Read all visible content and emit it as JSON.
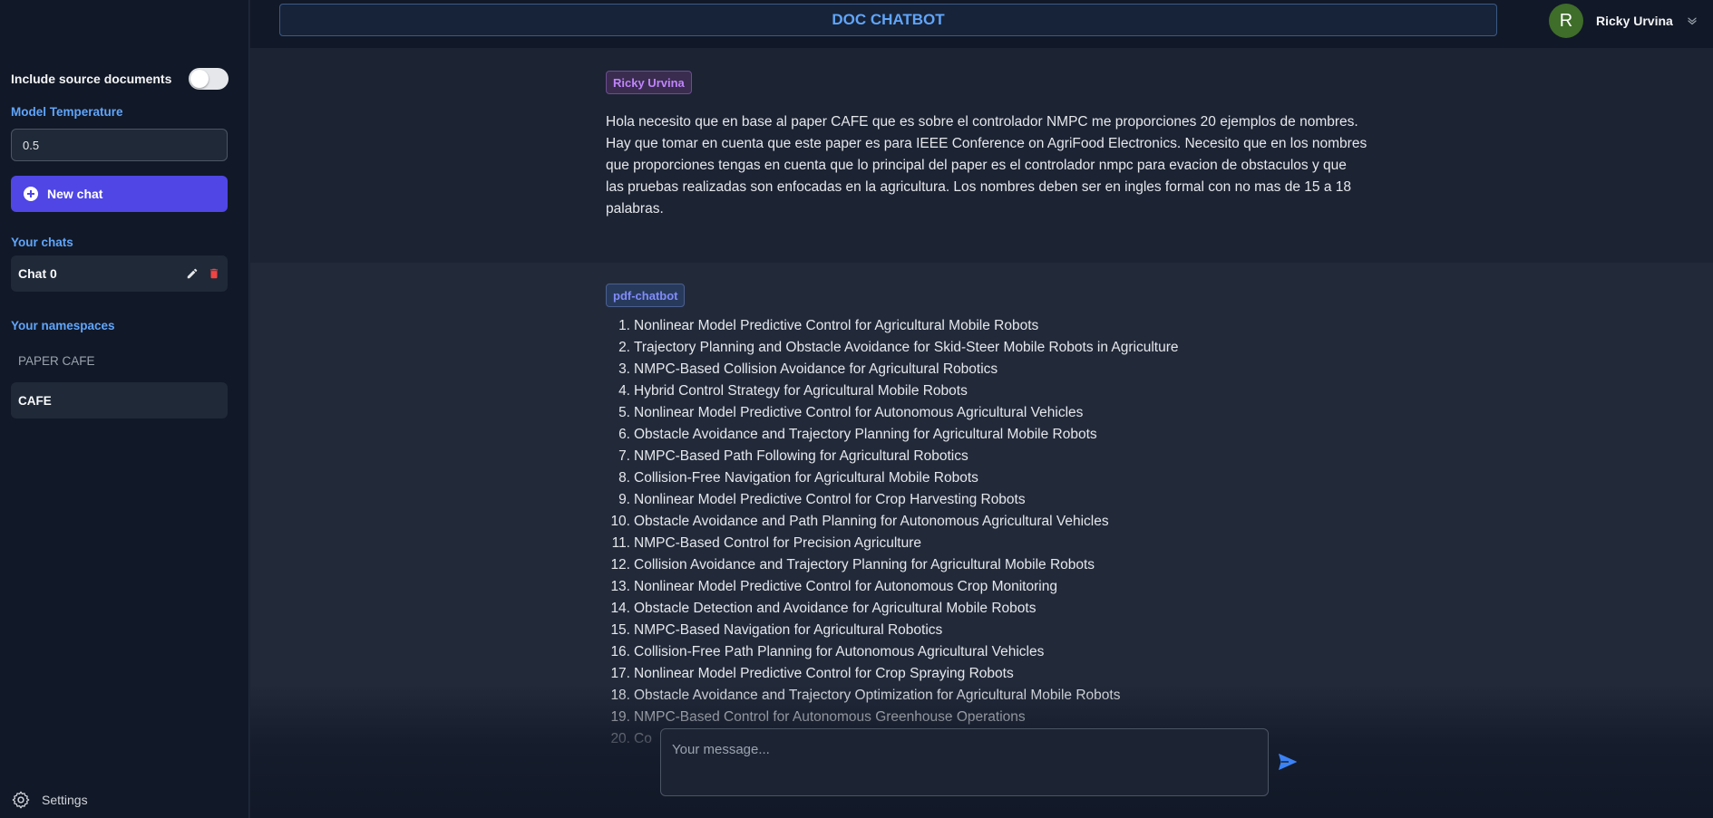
{
  "app": {
    "title": "DOC CHATBOT"
  },
  "user": {
    "name": "Ricky Urvina",
    "avatar_initial": "R"
  },
  "sidebar": {
    "include_source_label": "Include source documents",
    "include_source_enabled": false,
    "temperature_label": "Model Temperature",
    "temperature_value": "0.5",
    "new_chat_label": "New chat",
    "chats_label": "Your chats",
    "chats": [
      {
        "label": "Chat 0"
      }
    ],
    "namespaces_label": "Your namespaces",
    "namespaces": [
      {
        "label": "PAPER CAFE",
        "active": false
      },
      {
        "label": "CAFE",
        "active": true
      }
    ],
    "settings_label": "Settings"
  },
  "conversation": {
    "user_message": {
      "author": "Ricky Urvina",
      "text": "Hola necesito que en base al paper CAFE que es sobre el controlador NMPC me proporciones 20 ejemplos de nombres. Hay que tomar en cuenta que este paper es para IEEE Conference on AgriFood Electronics. Necesito que en los nombres que proporciones tengas en cuenta que lo principal del paper es el controlador nmpc para evacion de obstaculos y que las pruebas realizadas son enfocadas en la agricultura. Los nombres deben ser en ingles formal con no mas de 15 a 18 palabras."
    },
    "bot_message": {
      "author": "pdf-chatbot",
      "items": [
        {
          "num": "1.",
          "text": "Nonlinear Model Predictive Control for Agricultural Mobile Robots"
        },
        {
          "num": "2.",
          "text": "Trajectory Planning and Obstacle Avoidance for Skid-Steer Mobile Robots in Agriculture"
        },
        {
          "num": "3.",
          "text": "NMPC-Based Collision Avoidance for Agricultural Robotics"
        },
        {
          "num": "4.",
          "text": "Hybrid Control Strategy for Agricultural Mobile Robots"
        },
        {
          "num": "5.",
          "text": "Nonlinear Model Predictive Control for Autonomous Agricultural Vehicles"
        },
        {
          "num": "6.",
          "text": "Obstacle Avoidance and Trajectory Planning for Agricultural Mobile Robots"
        },
        {
          "num": "7.",
          "text": "NMPC-Based Path Following for Agricultural Robotics"
        },
        {
          "num": "8.",
          "text": "Collision-Free Navigation for Agricultural Mobile Robots"
        },
        {
          "num": "9.",
          "text": "Nonlinear Model Predictive Control for Crop Harvesting Robots"
        },
        {
          "num": "10.",
          "text": "Obstacle Avoidance and Path Planning for Autonomous Agricultural Vehicles"
        },
        {
          "num": "11.",
          "text": "NMPC-Based Control for Precision Agriculture"
        },
        {
          "num": "12.",
          "text": "Collision Avoidance and Trajectory Planning for Agricultural Mobile Robots"
        },
        {
          "num": "13.",
          "text": "Nonlinear Model Predictive Control for Autonomous Crop Monitoring"
        },
        {
          "num": "14.",
          "text": "Obstacle Detection and Avoidance for Agricultural Mobile Robots"
        },
        {
          "num": "15.",
          "text": "NMPC-Based Navigation for Agricultural Robotics"
        },
        {
          "num": "16.",
          "text": "Collision-Free Path Planning for Autonomous Agricultural Vehicles"
        },
        {
          "num": "17.",
          "text": "Nonlinear Model Predictive Control for Crop Spraying Robots"
        },
        {
          "num": "18.",
          "text": "Obstacle Avoidance and Trajectory Optimization for Agricultural Mobile Robots"
        },
        {
          "num": "19.",
          "text": "NMPC-Based Control for Autonomous Greenhouse Operations"
        },
        {
          "num": "20.",
          "text": "Co"
        }
      ]
    }
  },
  "composer": {
    "placeholder": "Your message..."
  },
  "colors": {
    "accent": "#4f46e5",
    "title_blue": "#60a5fa",
    "user_badge": "#c084fc",
    "bot_badge": "#818cf8",
    "delete_red": "#ef4444",
    "send_blue": "#3b82f6",
    "avatar_green": "#3f6d2a"
  },
  "icons": {
    "new_chat": "plus-circle-icon",
    "edit": "pencil-icon",
    "delete": "trash-icon",
    "settings": "gear-icon",
    "dropdown": "chevron-down-icon",
    "send": "paper-plane-icon"
  }
}
